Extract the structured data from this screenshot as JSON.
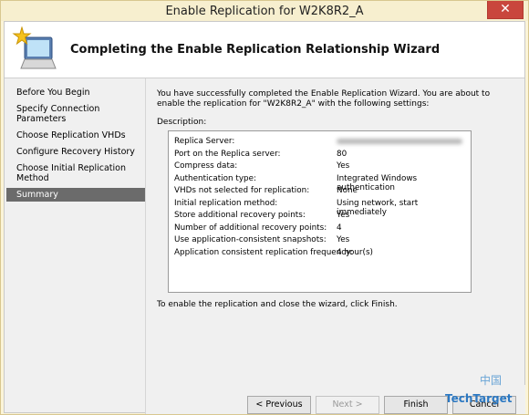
{
  "window": {
    "title": "Enable Replication for W2K8R2_A",
    "close_glyph": "✕"
  },
  "header": {
    "heading": "Completing the Enable Replication Relationship Wizard",
    "icon": "monitor-with-star-icon"
  },
  "nav": {
    "items": [
      {
        "label": "Before You Begin"
      },
      {
        "label": "Specify Connection Parameters"
      },
      {
        "label": "Choose Replication VHDs"
      },
      {
        "label": "Configure Recovery History"
      },
      {
        "label": "Choose Initial Replication Method"
      },
      {
        "label": "Summary",
        "selected": true
      }
    ]
  },
  "main": {
    "intro": "You have successfully completed the Enable Replication Wizard. You are about to enable the replication for \"W2K8R2_A\" with the following settings:",
    "description_label": "Description:",
    "settings": [
      {
        "key": "Replica Server:",
        "value": "",
        "blurred": true
      },
      {
        "key": "Port on the Replica server:",
        "value": "80"
      },
      {
        "key": "Compress data:",
        "value": "Yes"
      },
      {
        "key": "Authentication type:",
        "value": "Integrated Windows authentication"
      },
      {
        "key": "VHDs not selected for replication:",
        "value": "None"
      },
      {
        "key": "Initial replication method:",
        "value": "Using network, start immediately"
      },
      {
        "key": "Store additional recovery points:",
        "value": "Yes"
      },
      {
        "key": "Number of additional recovery points:",
        "value": "4"
      },
      {
        "key": "Use application-consistent snapshots:",
        "value": "Yes"
      },
      {
        "key": "Application consistent replication frequency:",
        "value": "4 hour(s)"
      }
    ],
    "finish_note": "To enable the replication and close the wizard, click Finish."
  },
  "buttons": {
    "previous": "< Previous",
    "next": "Next >",
    "finish": "Finish",
    "cancel": "Cancel"
  },
  "watermark": {
    "logo_text": "TechTarget",
    "chinese_text": "中国"
  },
  "colors": {
    "titlebar": "#f7efcf",
    "close": "#c9463d",
    "selected_nav": "#6b6b6b"
  }
}
